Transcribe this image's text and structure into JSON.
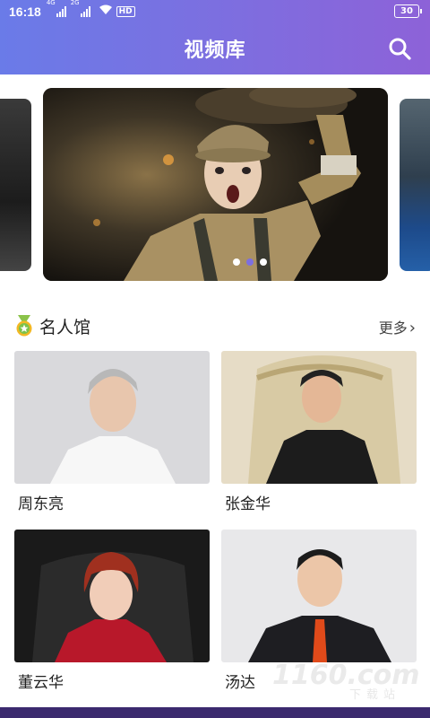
{
  "status_bar": {
    "time": "16:18",
    "network_1": "4G",
    "network_2": "2G",
    "hd_label": "HD",
    "battery": "30",
    "wifi_icon": "wifi-icon"
  },
  "header": {
    "title": "视频库",
    "search_icon": "search-icon",
    "gradient_start": "#6a7be8",
    "gradient_end": "#8d62d8"
  },
  "carousel": {
    "slide_count": 3,
    "active_index": 1,
    "accent": "#7c6fe0"
  },
  "section": {
    "icon": "medal-icon",
    "title": "名人馆",
    "more": "更多"
  },
  "celebrities": [
    {
      "name": "周东亮"
    },
    {
      "name": "张金华"
    },
    {
      "name": "董云华"
    },
    {
      "name": "汤达"
    }
  ],
  "watermark": {
    "brand": "1160.com",
    "caption": "下载站"
  }
}
